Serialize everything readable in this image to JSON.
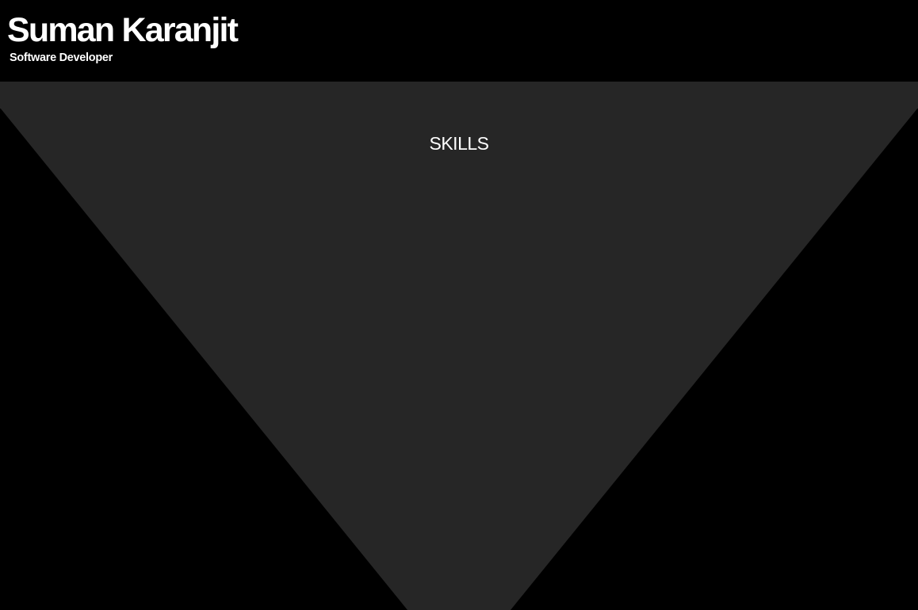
{
  "header": {
    "name": "Suman Karanjit",
    "role": "Software Developer"
  },
  "skills": {
    "title": "SKILLS"
  },
  "colors": {
    "page_background": "#000000",
    "panel": "#262626",
    "text": "#ffffff"
  }
}
